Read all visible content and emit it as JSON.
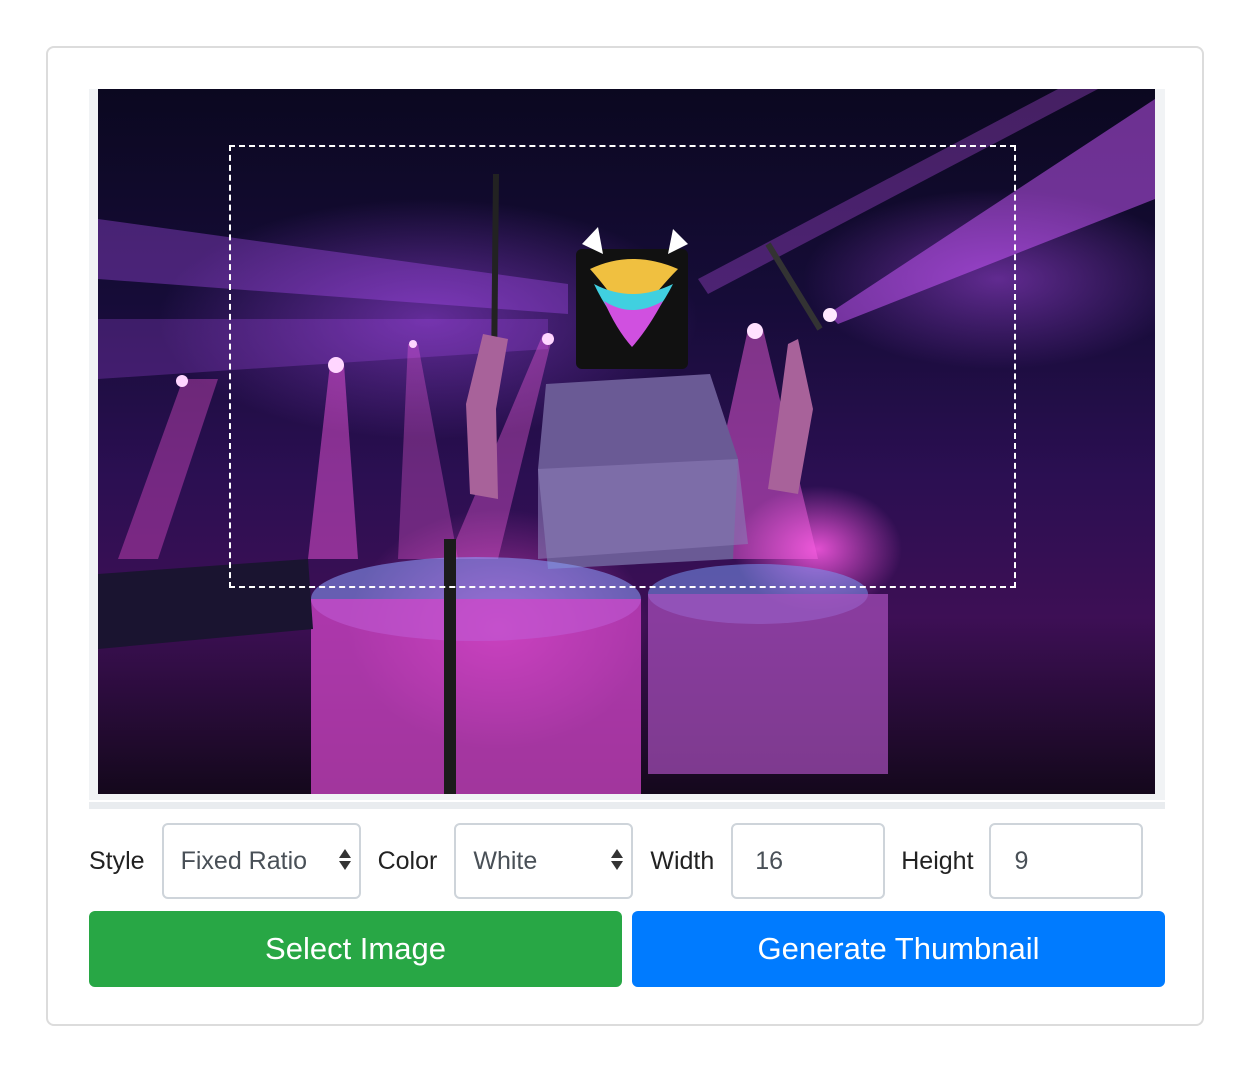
{
  "editor": {
    "image": {
      "subject": "drummer-with-illuminated-mask-on-stage",
      "accent_colors": [
        "#c06cf0",
        "#ff5ce0",
        "#2b0f52"
      ]
    },
    "crop_selection": {
      "style": "dashed",
      "border_color": "#ffffff"
    }
  },
  "controls": {
    "style_label": "Style",
    "style_value": "Fixed Ratio",
    "color_label": "Color",
    "color_value": "White",
    "width_label": "Width",
    "width_value": "16",
    "height_label": "Height",
    "height_value": "9"
  },
  "buttons": {
    "select_image": "Select Image",
    "generate_thumbnail": "Generate Thumbnail",
    "select_color": "#28a745",
    "generate_color": "#007bff"
  }
}
